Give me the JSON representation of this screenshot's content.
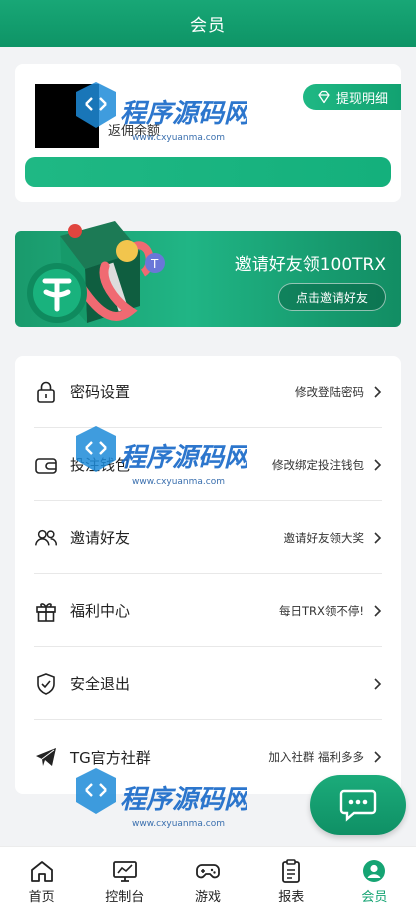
{
  "header": {
    "title": "会员"
  },
  "profile": {
    "rebate_label": "返佣余额",
    "withdraw_detail_label": "提现明细"
  },
  "invite_banner": {
    "title": "邀请好友领100TRX",
    "button_label": "点击邀请好友"
  },
  "menu": {
    "items": [
      {
        "label": "密码设置",
        "desc": "修改登陆密码",
        "icon": "lock-icon"
      },
      {
        "label": "投注钱包",
        "desc": "修改绑定投注钱包",
        "icon": "wallet-icon"
      },
      {
        "label": "邀请好友",
        "desc": "邀请好友领大奖",
        "icon": "users-icon"
      },
      {
        "label": "福利中心",
        "desc": "每日TRX领不停!",
        "icon": "gift-icon"
      },
      {
        "label": "安全退出",
        "desc": "",
        "icon": "shield-icon"
      },
      {
        "label": "TG官方社群",
        "desc": "加入社群 福利多多",
        "icon": "telegram-icon"
      }
    ]
  },
  "tabbar": {
    "tabs": [
      {
        "label": "首页",
        "icon": "home-icon"
      },
      {
        "label": "控制台",
        "icon": "console-icon"
      },
      {
        "label": "游戏",
        "icon": "gamepad-icon"
      },
      {
        "label": "报表",
        "icon": "clipboard-icon"
      },
      {
        "label": "会员",
        "icon": "user-circle-icon",
        "active": true
      }
    ]
  },
  "watermark": {
    "name": "程序源码网",
    "url": "www.cxyuanma.com"
  },
  "colors": {
    "brand_green": "#15a473",
    "dark_green": "#0e9466"
  }
}
